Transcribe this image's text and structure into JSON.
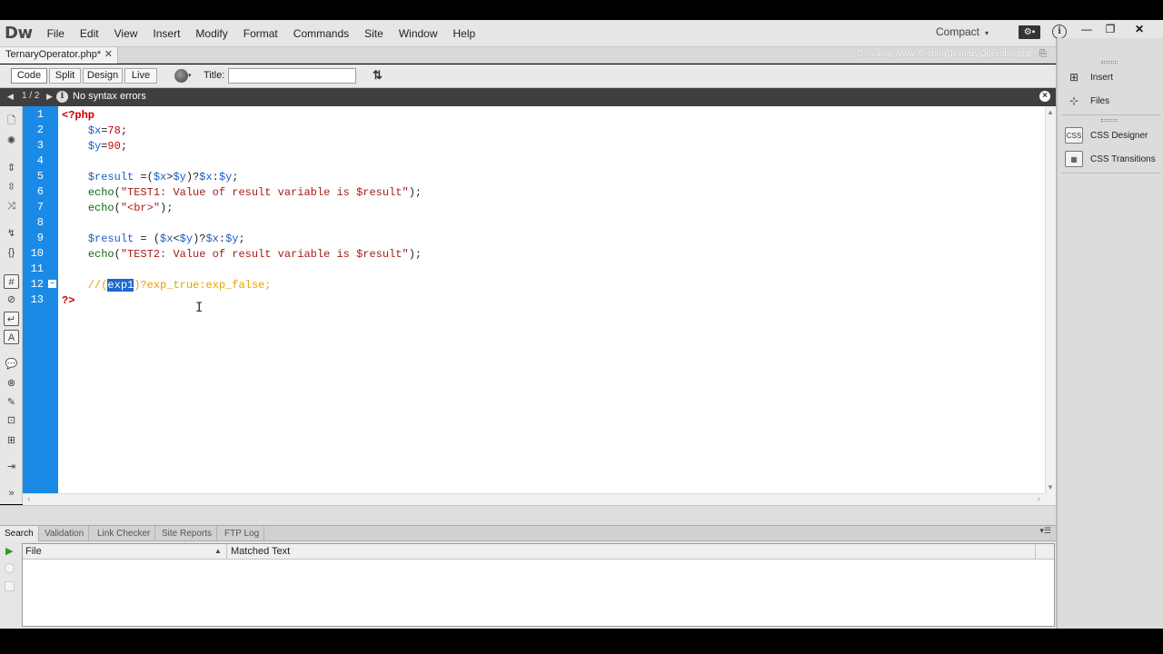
{
  "app": {
    "logo": "Dw",
    "menu": [
      "File",
      "Edit",
      "View",
      "Insert",
      "Modify",
      "Format",
      "Commands",
      "Site",
      "Window",
      "Help"
    ],
    "workspace": "Compact",
    "workspace_arrow": "▾",
    "window_controls": {
      "minimize": "—",
      "restore": "❐",
      "close": "✕"
    }
  },
  "document": {
    "tab_label": "TernaryOperator.php*",
    "tab_close": "✕",
    "path": "C:\\wamp\\www\\Testing\\TernaryOperator.php"
  },
  "viewbar": {
    "buttons": [
      "Code",
      "Split",
      "Design",
      "Live"
    ],
    "active": "Code",
    "title_label": "Title:",
    "title_value": ""
  },
  "infobar": {
    "count": "1 / 2",
    "message": "No syntax errors"
  },
  "code": {
    "line_numbers": [
      "1",
      "2",
      "3",
      "4",
      "5",
      "6",
      "7",
      "8",
      "9",
      "10",
      "11",
      "12",
      "13"
    ],
    "lines": [
      [
        {
          "c": "k-php",
          "t": "<?php"
        }
      ],
      [
        {
          "c": "",
          "t": "    "
        },
        {
          "c": "k-var",
          "t": "$x"
        },
        {
          "c": "",
          "t": "="
        },
        {
          "c": "k-num",
          "t": "78"
        },
        {
          "c": "",
          "t": ";"
        }
      ],
      [
        {
          "c": "",
          "t": "    "
        },
        {
          "c": "k-var",
          "t": "$y"
        },
        {
          "c": "",
          "t": "="
        },
        {
          "c": "k-num",
          "t": "90"
        },
        {
          "c": "",
          "t": ";"
        }
      ],
      [],
      [
        {
          "c": "",
          "t": "    "
        },
        {
          "c": "k-var",
          "t": "$result"
        },
        {
          "c": "",
          "t": " =("
        },
        {
          "c": "k-var",
          "t": "$x"
        },
        {
          "c": "",
          "t": ">"
        },
        {
          "c": "k-var",
          "t": "$y"
        },
        {
          "c": "",
          "t": ")?"
        },
        {
          "c": "k-var",
          "t": "$x"
        },
        {
          "c": "",
          "t": ":"
        },
        {
          "c": "k-var",
          "t": "$y"
        },
        {
          "c": "",
          "t": ";"
        }
      ],
      [
        {
          "c": "",
          "t": "    "
        },
        {
          "c": "k-fn",
          "t": "echo"
        },
        {
          "c": "",
          "t": "("
        },
        {
          "c": "k-str",
          "t": "\"TEST1: Value of result variable is $result\""
        },
        {
          "c": "",
          "t": ");"
        }
      ],
      [
        {
          "c": "",
          "t": "    "
        },
        {
          "c": "k-fn",
          "t": "echo"
        },
        {
          "c": "",
          "t": "("
        },
        {
          "c": "k-str",
          "t": "\"<br>\""
        },
        {
          "c": "",
          "t": ");"
        }
      ],
      [],
      [
        {
          "c": "",
          "t": "    "
        },
        {
          "c": "k-var",
          "t": "$result"
        },
        {
          "c": "",
          "t": " = ("
        },
        {
          "c": "k-var",
          "t": "$x"
        },
        {
          "c": "",
          "t": "<"
        },
        {
          "c": "k-var",
          "t": "$y"
        },
        {
          "c": "",
          "t": ")?"
        },
        {
          "c": "k-var",
          "t": "$x"
        },
        {
          "c": "",
          "t": ":"
        },
        {
          "c": "k-var",
          "t": "$y"
        },
        {
          "c": "",
          "t": ";"
        }
      ],
      [
        {
          "c": "",
          "t": "    "
        },
        {
          "c": "k-fn",
          "t": "echo"
        },
        {
          "c": "",
          "t": "("
        },
        {
          "c": "k-str",
          "t": "\"TEST2: Value of result variable is $result\""
        },
        {
          "c": "",
          "t": ");"
        }
      ],
      [],
      [
        {
          "c": "",
          "t": "    "
        },
        {
          "c": "k-cmt",
          "t": "//("
        },
        {
          "c": "k-sel",
          "t": "exp1"
        },
        {
          "c": "k-cmt",
          "t": ")?exp_true:exp_false;"
        }
      ],
      [
        {
          "c": "k-php",
          "t": "?>"
        }
      ]
    ]
  },
  "panel": {
    "tabs": [
      "Search",
      "Validation",
      "Link Checker",
      "Site Reports",
      "FTP Log"
    ],
    "active": "Search",
    "columns": {
      "file": "File",
      "matched": "Matched Text"
    }
  },
  "dock": {
    "items": [
      {
        "label": "Insert",
        "icon": "insert-icon"
      },
      {
        "label": "Files",
        "icon": "files-icon"
      },
      {
        "label": "CSS Designer",
        "icon": "css-designer-icon"
      },
      {
        "label": "CSS Transitions",
        "icon": "css-transitions-icon"
      }
    ]
  },
  "colors": {
    "gutter": "#1b8ae6",
    "selection": "#1e66d0",
    "comment": "#e5a100",
    "infobar": "#3f3f3f"
  }
}
